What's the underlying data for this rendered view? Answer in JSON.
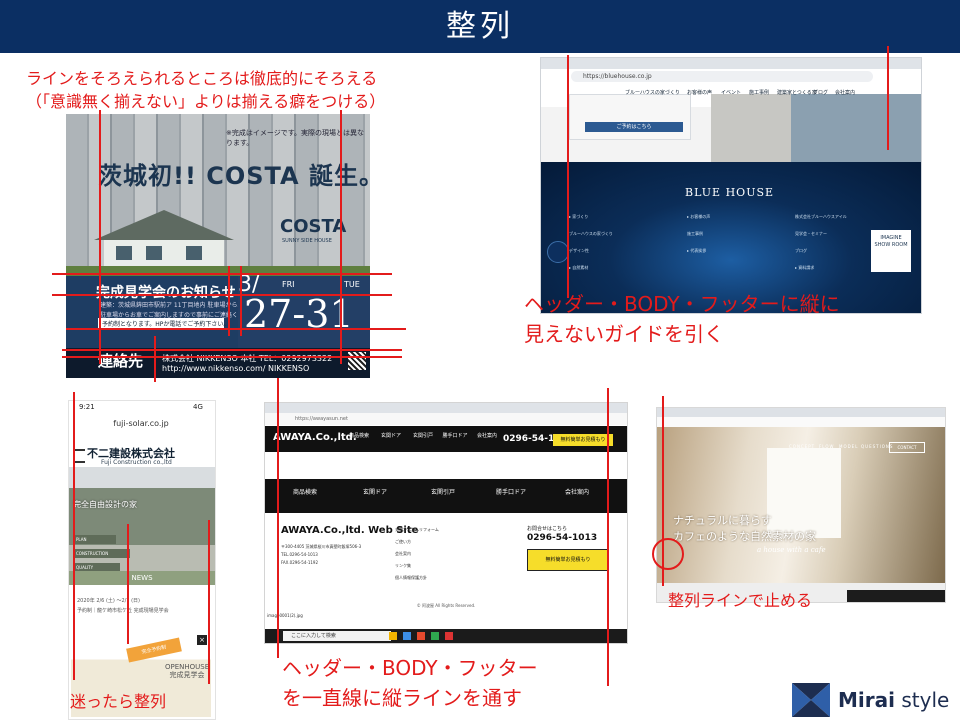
{
  "page": {
    "title": "整列",
    "colors": {
      "header_bg": "#0b2f63",
      "annotation_red": "#e31b1b",
      "brand_navy": "#1d2d50"
    }
  },
  "notes": {
    "top_left_line1": "ラインをそろえられるところは徹底的にそろえる",
    "top_left_line2": "（「意識無く揃えない」よりは揃える癖をつける）",
    "right_line1": "ヘッダー・BODY・フッターに縦に",
    "right_line2": "見えないガイドを引く",
    "bottom_center_line1": "ヘッダー・BODY・フッター",
    "bottom_center_line2": "を一直線に縦ラインを通す",
    "bottom_right": "整列ラインで止める",
    "bottom_left": "迷ったら整列"
  },
  "costa": {
    "note": "※完成はイメージです。実際の現場とは異なります。",
    "headline": "茨城初!! COSTA 誕生。",
    "brand": "COSTA",
    "brand_sub": "SUNNY SIDE HOUSE",
    "event_title": "完成見学会のお知らせ",
    "body_line1": "建築：茨城県鉾田市駅前ア 11丁目地内 駐車場から車で 10分",
    "body_line2": "駐車場からお車でご案内しますので事前にご連絡ください",
    "body_line3": "※駐車場完備です",
    "box_text": "予約制となります。HPか電話でご予約下さい。",
    "month": "3/",
    "day_fri": "FRI",
    "day_tue": "TUE",
    "dates": "27-31",
    "contact_label": "連絡先",
    "contact_text": "株式会社 NIKKENSO 本社  TEL：0292973322",
    "contact_url": "http://www.nikkenso.com/  NIKKENSO"
  },
  "bluehouse": {
    "url": "https://bluehouse.co.jp",
    "nav": [
      "ブルーハウスの家づくり",
      "お客様の声",
      "イベント",
      "施工事例",
      "建築家とつくる家",
      "ブログ",
      "会社案内"
    ],
    "reserve": "ご予約はこちら",
    "brand": "BLUE  HOUSE",
    "col1": [
      "▸ 家づくり",
      "ブルーハウスの家づくり",
      "デザイン性",
      "▸ 自然素材"
    ],
    "col2": [
      "▸ お客様の声",
      "施工事例",
      "▸ 代表挨拶"
    ],
    "col3": [
      "株式会社ブルーハウスアイル",
      "見学会・セミナー",
      "ブログ",
      "▸ 資料請求",
      "▸ 社長ブログ"
    ],
    "show_room": "IMAGINE SHOW ROOM"
  },
  "fuji": {
    "time": "9:21",
    "signal": "4G",
    "url": "fuji-solar.co.jp",
    "company": "不二建設株式会社",
    "company_en": "Fuji Construction co.,ltd",
    "photo_title": "完全自由設計の家",
    "tags": [
      "PLAN",
      "CONSTRUCTION",
      "QUALITY"
    ],
    "news_label": "NEWS",
    "news_line1": "2020年 2/6 (土) ～2/7 (日)",
    "news_line2": "予約制｜龍ケ崎市松ケ丘 完成現場見学会",
    "badge": "完全予約制",
    "openhouse": "OPENHOUSE 完成見学会"
  },
  "awaya": {
    "url": "https://awayasun.net",
    "logo": "AWAYA.Co.,ltd.",
    "menu": [
      "商品検索",
      "玄関ドア",
      "玄関引戸",
      "勝手口ドア",
      "会社案内"
    ],
    "phone": "0296-54-1013",
    "estimate": "無料簡単お見積もり",
    "band": [
      "商品検索",
      "玄関ドア",
      "玄関引戸",
      "勝手口ドア",
      "会社案内"
    ],
    "footer_logo": "AWAYA.Co.,ltd. Web Site",
    "address": "〒300-4405 茨城県桜川市真壁町飯塚506-3",
    "tel": "TEL.0296-54-1013",
    "fax": "FAX.0296-54-1192",
    "links": [
      "玄関かんたんリフォーム",
      "ご使い方",
      "会社案内",
      "リンク集",
      "個人情報保護方針"
    ],
    "contact": "お問合せはこちら",
    "copyright": "© 阿波屋 All Rights Reserved.",
    "download": "image0001(2).jpg",
    "search": "ここに入力して検索"
  },
  "natural": {
    "nav": [
      "CONCEPT",
      "FLOW",
      "MODEL",
      "QUESTIONS"
    ],
    "contact": "CONTACT",
    "copy1": "ナチュラルに暮らす",
    "copy2": "カフェのような自然素材の家",
    "copy3": "a house with a cafe"
  },
  "logo": {
    "name_bold": "Mirai",
    "name_regular": " style"
  }
}
